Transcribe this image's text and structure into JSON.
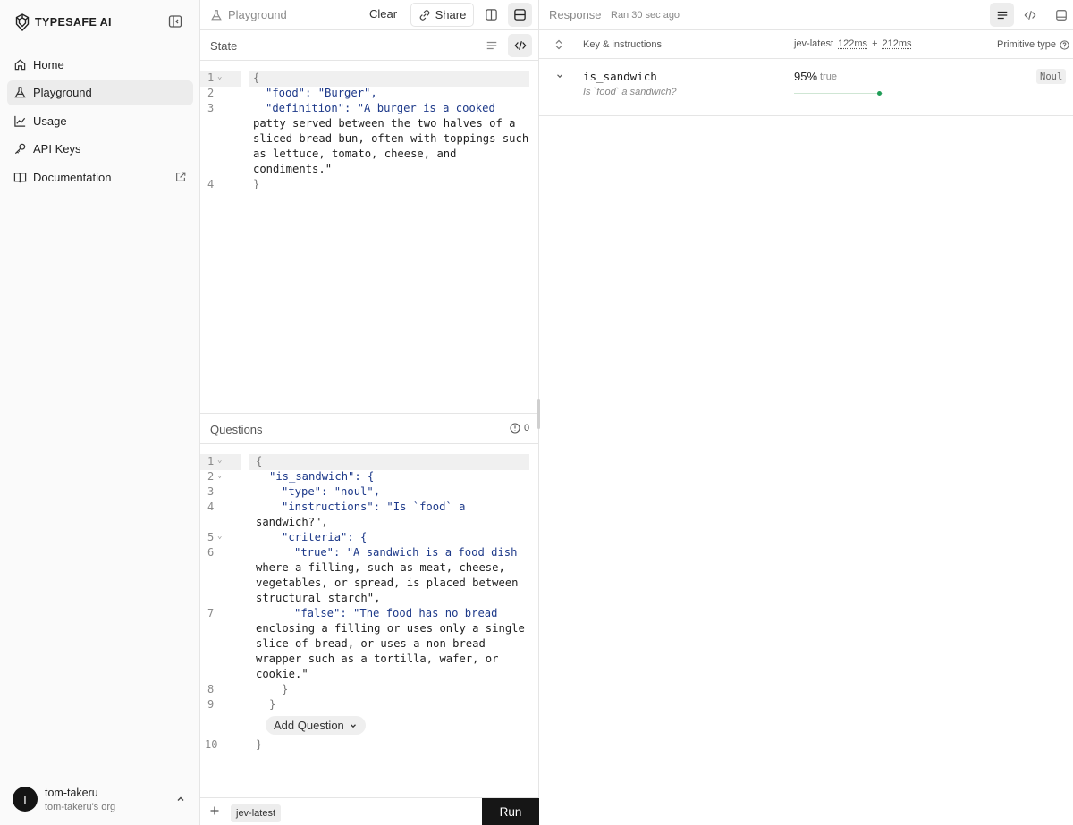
{
  "sidebar": {
    "brand": "TYPESAFE AI",
    "items": [
      {
        "label": "Home",
        "icon": "home-icon"
      },
      {
        "label": "Playground",
        "icon": "flask-icon",
        "active": true
      },
      {
        "label": "Usage",
        "icon": "chart-line-icon"
      },
      {
        "label": "API Keys",
        "icon": "key-icon"
      },
      {
        "label": "Documentation",
        "icon": "book-icon",
        "external": true
      }
    ],
    "user": {
      "initial": "T",
      "name": "tom-takeru",
      "org": "tom-takeru's org"
    }
  },
  "playground": {
    "title": "Playground",
    "clear_label": "Clear",
    "share_label": "Share",
    "state_title": "State",
    "questions_title": "Questions",
    "questions_error_count": "0",
    "add_question_label": "Add Question",
    "model": "jev-latest",
    "run_label": "Run",
    "state_line_numbers": [
      "1",
      "2",
      "3",
      "4"
    ],
    "state_code": [
      "{",
      "\"food\": \"Burger\",",
      "\"definition\": \"A burger is a cooked",
      "patty served between the two halves of a",
      "sliced bread bun, often with toppings such",
      "as lettuce, tomato, cheese, and",
      "condiments.\"",
      "}"
    ],
    "questions_line_numbers": [
      "1",
      "2",
      "3",
      "4",
      "5",
      "6",
      "7",
      "8",
      "9",
      "10"
    ],
    "questions_code": [
      "{",
      "\"is_sandwich\": {",
      "\"type\": \"noul\",",
      "\"instructions\": \"Is `food` a",
      "sandwich?\",",
      "\"criteria\": {",
      "\"true\": \"A sandwich is a food dish",
      "where a filling, such as meat, cheese,",
      "vegetables, or spread, is placed between",
      "structural starch\",",
      "\"false\": \"The food has no bread",
      "enclosing a filling or uses only a single",
      "slice of bread, or uses a non-bread",
      "wrapper such as a tortilla, wafer, or",
      "cookie.\"",
      "}",
      "}",
      "}"
    ]
  },
  "response": {
    "title": "Response",
    "ran_text": "Ran 30 sec ago",
    "columns": {
      "key": "Key & instructions",
      "model": "jev-latest",
      "time1": "122ms",
      "plus": "+",
      "time2": "212ms",
      "type": "Primitive type"
    },
    "rows": [
      {
        "key": "is_sandwich",
        "instructions": "Is `food` a sandwich?",
        "percent": "95%",
        "percent_value": 95,
        "value": "true",
        "type": "Noul"
      }
    ]
  },
  "colors": {
    "accent_dark": "#161616",
    "success": "#1f9d57",
    "key_text": "#1e3a8a",
    "string_pink": "#b0459b"
  }
}
